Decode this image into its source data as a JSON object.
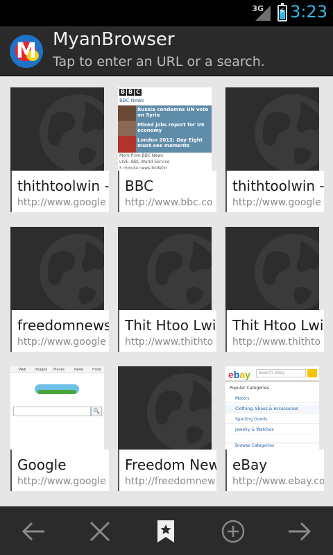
{
  "status_bar": {
    "network": "3G",
    "time": "3:23"
  },
  "header": {
    "title": "MyanBrowser",
    "subtitle": "Tap to enter an URL or a search."
  },
  "bookmarks": [
    {
      "title": "thithtoolwin -",
      "url": "http://www.google",
      "thumb": "placeholder-globe"
    },
    {
      "title": "BBC",
      "url": "http://www.bbc.co",
      "thumb": "bbc"
    },
    {
      "title": "thithtoolwin -",
      "url": "http://www.google",
      "thumb": "placeholder-globe"
    },
    {
      "title": "freedomnews",
      "url": "http://www.google",
      "thumb": "placeholder-globe"
    },
    {
      "title": "Thit Htoo Lwin",
      "url": "http://www.thithto",
      "thumb": "placeholder-globe"
    },
    {
      "title": "Thit Htoo Lwin",
      "url": "http://www.thithto",
      "thumb": "placeholder-globe"
    },
    {
      "title": "Google",
      "url": "http://www.google",
      "thumb": "google"
    },
    {
      "title": "Freedom New",
      "url": "http://freedomnew",
      "thumb": "placeholder-globe"
    },
    {
      "title": "eBay",
      "url": "http://www.ebay.co",
      "thumb": "ebay"
    }
  ],
  "bbc_thumb": {
    "logo": [
      "B",
      "B",
      "C"
    ],
    "section": "BBC News",
    "stories": [
      "Russia condemns UN vote on Syria",
      "Mixed jobs report for US economy",
      "London 2012: Day Eight must-see moments"
    ],
    "links": [
      "More from BBC News",
      "LIVE: BBC World Service",
      "5 minute news bulletin"
    ]
  },
  "google_thumb": {
    "tabs": [
      "Web",
      "Images",
      "Places",
      "News",
      "more"
    ],
    "search_button": "🔍"
  },
  "ebay_thumb": {
    "logo_letters": [
      {
        "ch": "e",
        "color": "#e53238"
      },
      {
        "ch": "b",
        "color": "#0064d2"
      },
      {
        "ch": "a",
        "color": "#f5af02"
      },
      {
        "ch": "y",
        "color": "#86b817"
      }
    ],
    "search_placeholder": "Search eBay",
    "popular_heading": "Popular Categories",
    "categories": [
      "Motors",
      "Clothing, Shoes & Accessories",
      "Sporting Goods",
      "Jewelry & Watches"
    ],
    "browse": "Browse Categories"
  },
  "toolbar": {
    "items": [
      {
        "name": "back-button",
        "icon": "arrow-left-icon"
      },
      {
        "name": "close-button",
        "icon": "close-icon"
      },
      {
        "name": "bookmarks-button",
        "icon": "bookmark-star-icon"
      },
      {
        "name": "new-tab-button",
        "icon": "plus-circle-icon"
      },
      {
        "name": "forward-button",
        "icon": "arrow-right-icon"
      }
    ]
  },
  "colors": {
    "accent": "#33b5e5",
    "title_bar": "#2a2a2a",
    "toolbar": "#2b2b2b",
    "grid_bg": "#e6e6e6"
  }
}
